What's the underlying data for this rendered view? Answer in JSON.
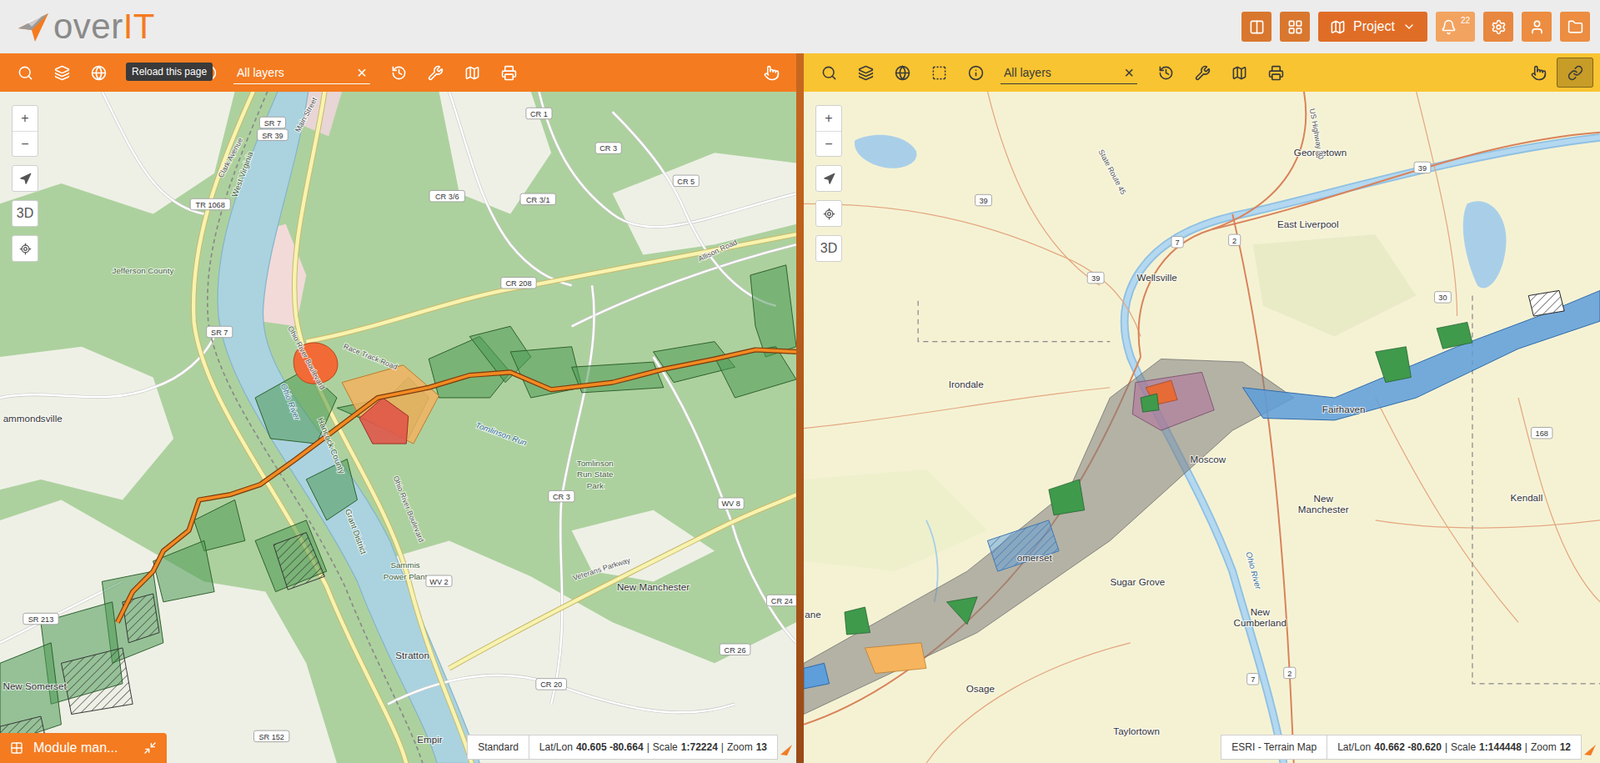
{
  "header": {
    "logo": {
      "text": "over",
      "accent": "IT"
    },
    "buttons": [
      {
        "kind": "split"
      },
      {
        "kind": "widgets"
      },
      {
        "kind": "project",
        "label": "Project"
      },
      {
        "kind": "notifications",
        "badge": "22"
      },
      {
        "kind": "settings"
      },
      {
        "kind": "user"
      },
      {
        "kind": "folder"
      }
    ]
  },
  "panels": [
    {
      "color": "#f47b20",
      "map": "street",
      "toolbar": {
        "leading": [
          {
            "kind": "search"
          },
          {
            "kind": "layers"
          },
          {
            "kind": "globe"
          },
          {
            "kind": "reload",
            "tooltip": "Reload this page"
          },
          {
            "kind": "select"
          },
          {
            "kind": "info"
          }
        ],
        "search": {
          "value": "All layers",
          "clear": "×"
        },
        "trailing": [
          {
            "kind": "history"
          },
          {
            "kind": "tools"
          },
          {
            "kind": "map"
          },
          {
            "kind": "print"
          }
        ],
        "end": [
          {
            "kind": "touch",
            "selected": false
          }
        ]
      },
      "controls": [
        {
          "kind": "zoom",
          "labels": [
            "+",
            "−"
          ]
        },
        {
          "kind": "compass"
        },
        {
          "kind": "text",
          "label": "3D"
        },
        {
          "kind": "locate"
        }
      ],
      "status": {
        "basemap": "Standard",
        "separator": "|",
        "coords": [
          {
            "label": "Lat/Lon",
            "value": "40.605 -80.664"
          },
          {
            "label": "Scale",
            "value": "1:72224"
          },
          {
            "label": "Zoom",
            "value": "13"
          }
        ]
      },
      "labels": [
        {
          "text": "SR 7",
          "kind": "shield"
        },
        {
          "text": "SR 39",
          "kind": "shield"
        },
        {
          "text": "Clark Avenue",
          "kind": "road"
        },
        {
          "text": "Main Street",
          "kind": "road"
        },
        {
          "text": "West Virginia",
          "kind": "area"
        },
        {
          "text": "TR 1068",
          "kind": "shield"
        },
        {
          "text": "Jefferson County",
          "kind": "area"
        },
        {
          "text": "SR 7",
          "kind": "shield"
        },
        {
          "text": "ammondsville",
          "kind": "place"
        },
        {
          "text": "Ohio River Boulevard",
          "kind": "road"
        },
        {
          "text": "Ohio River",
          "kind": "water"
        },
        {
          "text": "Hancock County",
          "kind": "area"
        },
        {
          "text": "Race Track Road",
          "kind": "road"
        },
        {
          "text": "CR 1",
          "kind": "shield"
        },
        {
          "text": "CR 3",
          "kind": "shield"
        },
        {
          "text": "CR 3/6",
          "kind": "shield"
        },
        {
          "text": "CR 3/1",
          "kind": "shield"
        },
        {
          "text": "CR 5",
          "kind": "shield"
        },
        {
          "text": "CR 208",
          "kind": "shield"
        },
        {
          "text": "Allison Road",
          "kind": "road"
        },
        {
          "text": "Tomlinson Run",
          "kind": "water"
        },
        {
          "text": "Tomlinson",
          "kind": "area"
        },
        {
          "text": "Run State",
          "kind": "area"
        },
        {
          "text": "Park",
          "kind": "area"
        },
        {
          "text": "CR 3",
          "kind": "shield"
        },
        {
          "text": "WV 8",
          "kind": "shield"
        },
        {
          "text": "Grant District",
          "kind": "area"
        },
        {
          "text": "Ohio River Boulevard",
          "kind": "road"
        },
        {
          "text": "Sammis",
          "kind": "area"
        },
        {
          "text": "Power Plant",
          "kind": "area"
        },
        {
          "text": "WV 2",
          "kind": "shield"
        },
        {
          "text": "Veterans Parkway",
          "kind": "road"
        },
        {
          "text": "New Manchester",
          "kind": "place"
        },
        {
          "text": "CR 24",
          "kind": "shield"
        },
        {
          "text": "CR 26",
          "kind": "shield"
        },
        {
          "text": "Stratton",
          "kind": "place"
        },
        {
          "text": "CR 20",
          "kind": "shield"
        },
        {
          "text": "SR 213",
          "kind": "shield"
        },
        {
          "text": "New Somerset",
          "kind": "place"
        },
        {
          "text": "SR 152",
          "kind": "shield"
        },
        {
          "text": "Empir",
          "kind": "place"
        }
      ],
      "module": {
        "label": "Module man..."
      }
    },
    {
      "color": "#f9c431",
      "map": "terrain",
      "toolbar": {
        "leading": [
          {
            "kind": "search"
          },
          {
            "kind": "layers"
          },
          {
            "kind": "globe"
          },
          {
            "kind": "select"
          },
          {
            "kind": "info"
          }
        ],
        "search": {
          "value": "All layers",
          "clear": "×"
        },
        "trailing": [
          {
            "kind": "history"
          },
          {
            "kind": "tools"
          },
          {
            "kind": "map"
          },
          {
            "kind": "print"
          }
        ],
        "end": [
          {
            "kind": "touch",
            "selected": false
          },
          {
            "kind": "link",
            "selected": true
          }
        ]
      },
      "controls": [
        {
          "kind": "zoom",
          "labels": [
            "+",
            "−"
          ]
        },
        {
          "kind": "compass"
        },
        {
          "kind": "locate"
        },
        {
          "kind": "text",
          "label": "3D"
        }
      ],
      "status": {
        "basemap": "ESRI - Terrain Map",
        "separator": "|",
        "coords": [
          {
            "label": "Lat/Lon",
            "value": "40.662 -80.620"
          },
          {
            "label": "Scale",
            "value": "1:144448"
          },
          {
            "label": "Zoom",
            "value": "12"
          }
        ]
      },
      "labels": [
        {
          "text": "Georgetown",
          "kind": "place"
        },
        {
          "text": "US Highway 30",
          "kind": "road"
        },
        {
          "text": "State Route 45",
          "kind": "road"
        },
        {
          "text": "39",
          "kind": "shield"
        },
        {
          "text": "39",
          "kind": "shield"
        },
        {
          "text": "East Liverpool",
          "kind": "place"
        },
        {
          "text": "7",
          "kind": "shield"
        },
        {
          "text": "2",
          "kind": "shield"
        },
        {
          "text": "39",
          "kind": "shield"
        },
        {
          "text": "Wellsville",
          "kind": "place"
        },
        {
          "text": "30",
          "kind": "shield"
        },
        {
          "text": "Irondale",
          "kind": "place"
        },
        {
          "text": "Fairhaven",
          "kind": "place"
        },
        {
          "text": "168",
          "kind": "shield"
        },
        {
          "text": "Moscow",
          "kind": "place"
        },
        {
          "text": "New",
          "kind": "place"
        },
        {
          "text": "Manchester",
          "kind": "place"
        },
        {
          "text": "Kendall",
          "kind": "place"
        },
        {
          "text": "omerset",
          "kind": "place"
        },
        {
          "text": "Ohio River",
          "kind": "water"
        },
        {
          "text": "Sugar Grove",
          "kind": "place"
        },
        {
          "text": "New",
          "kind": "place"
        },
        {
          "text": "Cumberland",
          "kind": "place"
        },
        {
          "text": "ane",
          "kind": "place"
        },
        {
          "text": "7",
          "kind": "shield"
        },
        {
          "text": "2",
          "kind": "shield"
        },
        {
          "text": "Osage",
          "kind": "place"
        },
        {
          "text": "Taylortown",
          "kind": "place"
        }
      ],
      "module": null
    }
  ]
}
